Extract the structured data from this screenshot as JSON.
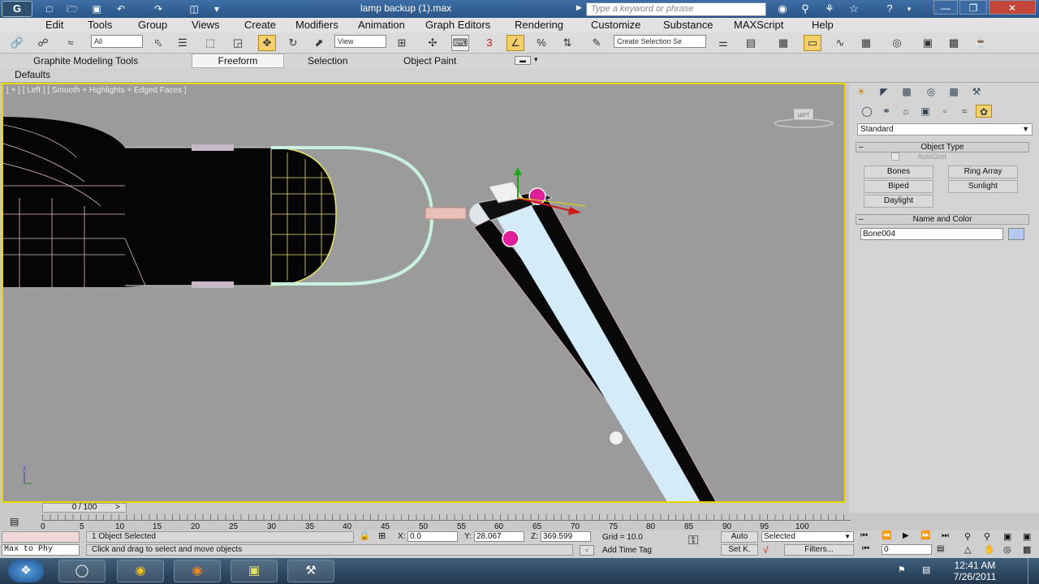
{
  "window": {
    "title": "lamp backup (1).max",
    "search_placeholder": "Type a keyword or phrase",
    "app_logo": "G"
  },
  "menu": [
    "Edit",
    "Tools",
    "Group",
    "Views",
    "Create",
    "Modifiers",
    "Animation",
    "Graph Editors",
    "Rendering",
    "Customize",
    "Substance",
    "MAXScript",
    "Help"
  ],
  "toolbar": {
    "selection_filter": "All",
    "ref_coord": "View",
    "named_selection_placeholder": "Create Selection Se",
    "snap_label": "3",
    "angle_snap": "%"
  },
  "ribbon": {
    "tabs": [
      "Graphite Modeling Tools",
      "Freeform",
      "Selection",
      "Object Paint"
    ],
    "defaults_label": "Defaults"
  },
  "viewport": {
    "label": "[ + ] [ Left ] [ Smooth + Highlights + Edged Faces ]",
    "viewcube_label": "LEFT",
    "axis_z": "z"
  },
  "command_panel": {
    "category": "Standard",
    "object_type_title": "Object Type",
    "autogrid_label": "AutoGrid",
    "buttons": [
      "Bones",
      "Ring Array",
      "Biped",
      "Sunlight",
      "Daylight"
    ],
    "name_color_title": "Name and Color",
    "object_name": "Bone004",
    "object_color": "#b4c8f0"
  },
  "timeline": {
    "slider_label": "0 / 100",
    "ticks": [
      "0",
      "5",
      "10",
      "15",
      "20",
      "25",
      "30",
      "35",
      "40",
      "45",
      "50",
      "55",
      "60",
      "65",
      "70",
      "75",
      "80",
      "85",
      "90",
      "95",
      "100"
    ]
  },
  "status": {
    "script_prefix": "Max to Phy",
    "selection_count": "1 Object Selected",
    "prompt": "Click and drag to select and move objects",
    "x_value": "0.0",
    "y_value": "28.067",
    "z_value": "369.599",
    "grid": "Grid = 10.0",
    "add_time_tag": "Add Time Tag",
    "auto_key": "Auto",
    "set_key": "Set K.",
    "selected_dropdown": "Selected",
    "filters": "Filters...",
    "frame": "0",
    "x_label": "X:",
    "y_label": "Y:",
    "z_label": "Z:"
  },
  "taskbar": {
    "time": "12:41 AM",
    "date": "7/26/2011"
  }
}
